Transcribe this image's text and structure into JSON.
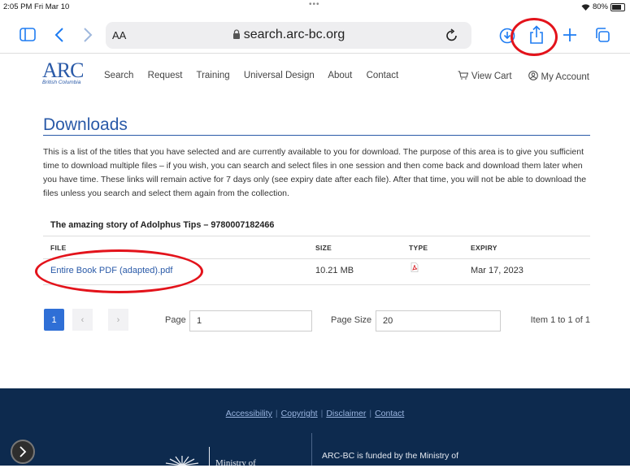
{
  "status_bar": {
    "time": "2:05 PM  Fri Mar 10",
    "dots": "•••",
    "battery": "80%"
  },
  "browser": {
    "text_size_label": "AA",
    "url": "search.arc-bc.org"
  },
  "site_nav": {
    "logo_text": "ARC",
    "logo_subtext": "British Columbia",
    "links": [
      "Search",
      "Request",
      "Training",
      "Universal Design",
      "About",
      "Contact"
    ],
    "view_cart": "View Cart",
    "my_account": "My Account"
  },
  "page": {
    "title": "Downloads",
    "intro": "This is a list of the titles that you have selected and are currently available to you for download. The purpose of this area is to give you sufficient time to download multiple files – if you wish, you can search and select files in one session and then come back and download them later when you have time. These links will remain active for 7 days only (see expiry date after each file). After that time, you will not be able to download the files unless you search and select them again from the collection.",
    "book_title": "The amazing story of Adolphus Tips – 9780007182466"
  },
  "table": {
    "headers": {
      "file": "FILE",
      "size": "SIZE",
      "type": "TYPE",
      "expiry": "EXPIRY"
    },
    "rows": [
      {
        "file": "Entire Book PDF (adapted).pdf",
        "size": "10.21 MB",
        "type_icon": "pdf-icon",
        "expiry": "Mar 17, 2023"
      }
    ]
  },
  "pagination": {
    "current": "1",
    "prev": "‹",
    "next": "›",
    "page_label": "Page",
    "page_value": "1",
    "size_label": "Page Size",
    "size_value": "20",
    "info": "Item 1 to 1 of 1"
  },
  "footer": {
    "links": [
      "Accessibility",
      "Copyright",
      "Disclaimer",
      "Contact"
    ],
    "ministry_text": "Ministry of",
    "funding_text": "ARC-BC is funded by the Ministry of"
  },
  "colors": {
    "brand": "#2a5aa8",
    "footer_bg": "#0d2a4e",
    "ios_blue": "#1e7cf2",
    "annotation_red": "#e3131b"
  }
}
